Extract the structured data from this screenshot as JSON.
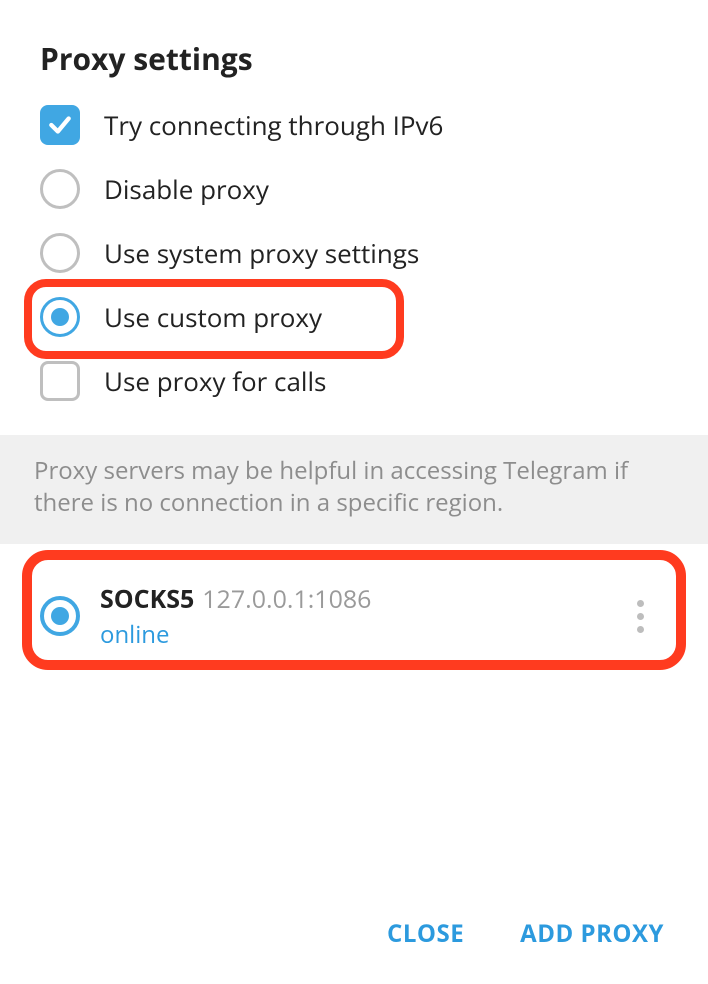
{
  "title": "Proxy settings",
  "options": {
    "ipv6": {
      "label": "Try connecting through IPv6",
      "checked": true
    },
    "disable": {
      "label": "Disable proxy",
      "selected": false
    },
    "system": {
      "label": "Use system proxy settings",
      "selected": false
    },
    "custom": {
      "label": "Use custom proxy",
      "selected": true
    },
    "calls": {
      "label": "Use proxy for calls",
      "checked": false
    }
  },
  "hint": "Proxy servers may be helpful in accessing Telegram if there is no connection in a specific region.",
  "proxies": [
    {
      "type": "SOCKS5",
      "address": "127.0.0.1:1086",
      "status": "online",
      "selected": true
    }
  ],
  "footer": {
    "close": "CLOSE",
    "add": "ADD PROXY"
  },
  "colors": {
    "accent": "#40a7e3",
    "link": "#2c9ade",
    "highlight": "#ff3b1f"
  }
}
